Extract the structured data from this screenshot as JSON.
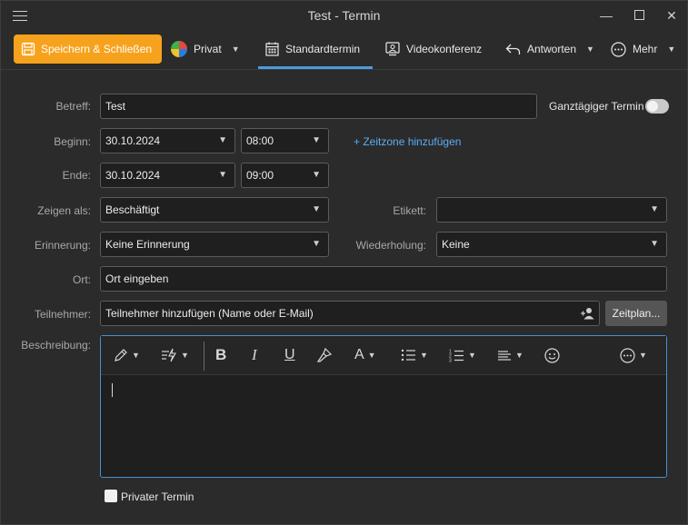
{
  "window": {
    "title": "Test - Termin",
    "menu_icon": "hamburger-icon",
    "minimize_icon": "minimize-icon",
    "maximize_icon": "maximize-icon",
    "close_icon": "close-icon"
  },
  "ribbon": {
    "save_close": "Speichern & Schließen",
    "category": "Privat",
    "standard": "Standardtermin",
    "video": "Videokonferenz",
    "reply": "Antworten",
    "more": "Mehr",
    "active_tab": "Standardtermin",
    "accent_color": "#f7a21c",
    "tab_accent_color": "#4a9be0"
  },
  "form": {
    "subject_label": "Betreff:",
    "subject_value": "Test",
    "allday_label": "Ganztägiger Termin",
    "begin_label": "Beginn:",
    "begin_date": "30.10.2024",
    "begin_time": "08:00",
    "timezone_link": "+ Zeitzone hinzufügen",
    "end_label": "Ende:",
    "end_date": "30.10.2024",
    "end_time": "09:00",
    "show_as_label": "Zeigen als:",
    "show_as_value": "Beschäftigt",
    "tag_label": "Etikett:",
    "tag_value": "",
    "reminder_label": "Erinnerung:",
    "reminder_value": "Keine Erinnerung",
    "repeat_label": "Wiederholung:",
    "repeat_value": "Keine",
    "location_label": "Ort:",
    "location_placeholder": "Ort eingeben",
    "attendees_label": "Teilnehmer:",
    "attendees_placeholder": "Teilnehmer hinzufügen (Name oder E-Mail)",
    "schedule_button": "Zeitplan...",
    "description_label": "Beschreibung:",
    "private_label": "Privater Termin"
  },
  "editor_toolbar": {
    "bold": "B",
    "italic": "I",
    "underline": "U",
    "font_color": "A"
  }
}
